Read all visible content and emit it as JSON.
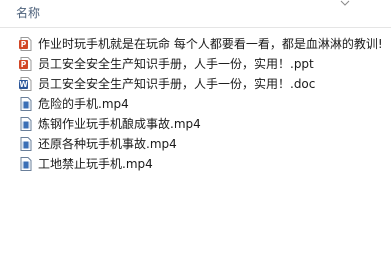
{
  "header": {
    "name_column_label": "名称"
  },
  "files": [
    {
      "name": "作业时玩手机就是在玩命  每个人都要看一看，都是血淋淋的教训!",
      "type": "pptx-icon",
      "color": "#d24726"
    },
    {
      "name": "员工安全安全生产知识手册，人手一份，实用！.ppt",
      "type": "ppt-icon",
      "color": "#d24726"
    },
    {
      "name": "员工安全安全生产知识手册，人手一份，实用！.doc",
      "type": "doc-icon",
      "color": "#2b579a"
    },
    {
      "name": "危险的手机.mp4",
      "type": "video-icon",
      "color": "#3b6fb6"
    },
    {
      "name": "炼钢作业玩手机酿成事故.mp4",
      "type": "video-icon",
      "color": "#3b6fb6"
    },
    {
      "name": "还原各种玩手机事故.mp4",
      "type": "video-icon",
      "color": "#3b6fb6"
    },
    {
      "name": "工地禁止玩手机.mp4",
      "type": "video-icon",
      "color": "#3b6fb6"
    }
  ]
}
